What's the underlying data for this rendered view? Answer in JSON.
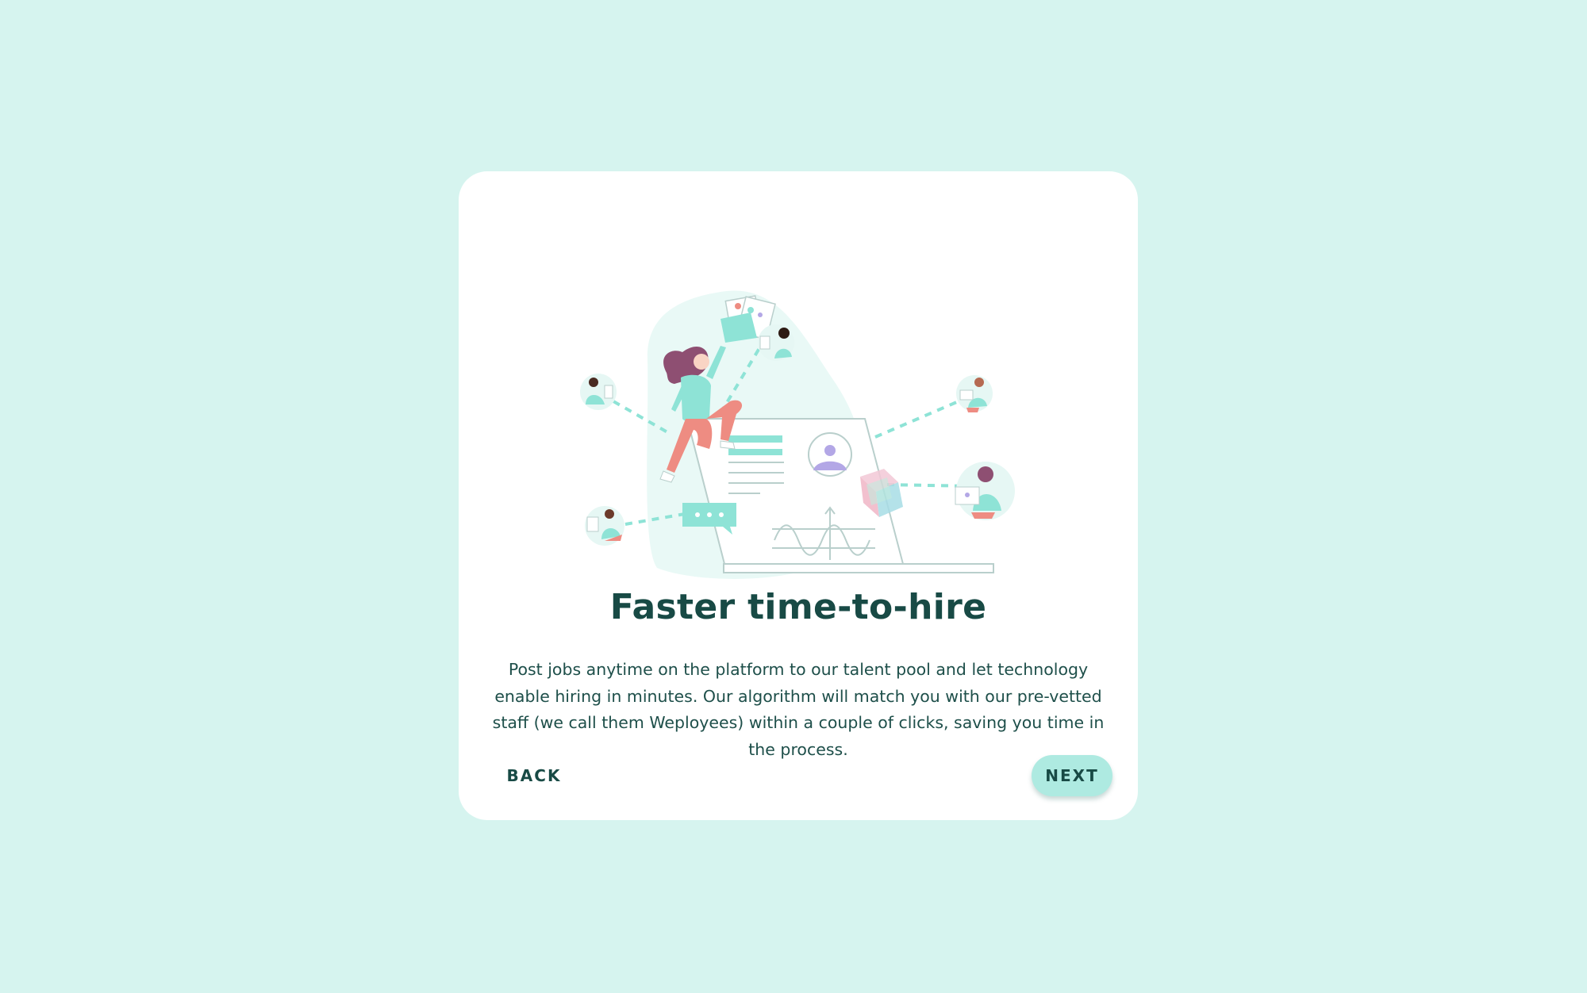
{
  "onboarding": {
    "title": "Faster time-to-hire",
    "description": "Post jobs anytime on the platform to our talent pool and let technology enable hiring in minutes. Our algorithm will match you with our pre-vetted staff (we call them Weployees) within a couple of clicks, saving you time in the process.",
    "back_label": "BACK",
    "next_label": "NEXT"
  },
  "colors": {
    "page_background": "#d6f4ef",
    "card_background": "#ffffff",
    "heading": "#184a45",
    "accent_mint": "#8ee3d6",
    "next_button": "#aeeae1",
    "figure_pants": "#ee8c82",
    "figure_hair": "#8e4f72",
    "avatar_purple": "#b3a7e6"
  },
  "illustration": {
    "icons": [
      "hiring-platform-illustration",
      "profile-avatar-icon",
      "chat-bubble-icon",
      "cube-icon",
      "wave-chart-icon",
      "resume-cards-icon"
    ]
  }
}
